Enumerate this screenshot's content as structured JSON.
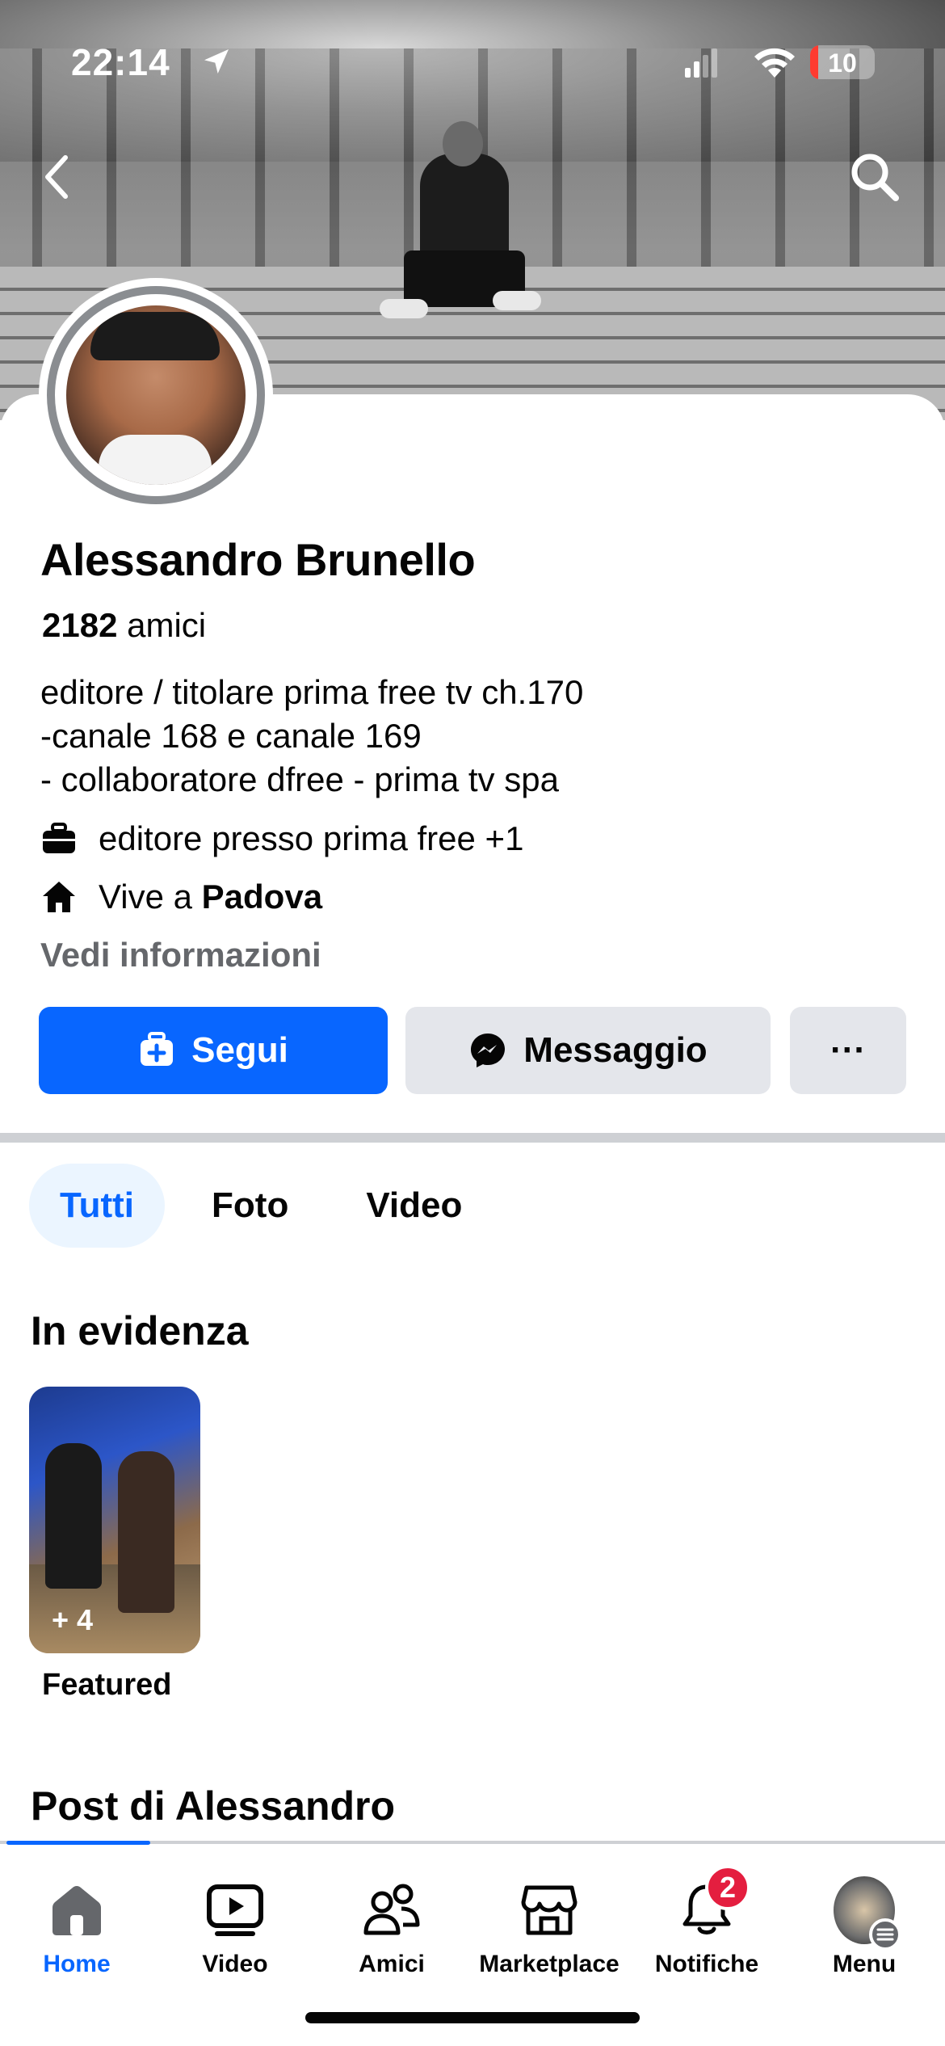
{
  "status_bar": {
    "time": "22:14",
    "battery": "10"
  },
  "profile": {
    "name": "Alessandro Brunello",
    "friends_count": "2182",
    "friends_label": "amici",
    "bio_lines": [
      "editore / titolare prima free tv ch.170",
      "-canale 168 e canale 169",
      "- collaboratore dfree - prima tv spa"
    ],
    "work": "editore presso prima free +1",
    "lives_prefix": "Vive a",
    "lives_city": "Padova",
    "see_info": "Vedi informazioni"
  },
  "actions": {
    "follow": "Segui",
    "message": "Messaggio",
    "more": "···"
  },
  "tabs": [
    {
      "label": "Tutti",
      "active": true
    },
    {
      "label": "Foto",
      "active": false
    },
    {
      "label": "Video",
      "active": false
    }
  ],
  "featured": {
    "title": "In evidenza",
    "item_count_label": "+ 4",
    "item_label": "Featured"
  },
  "posts": {
    "title": "Post di Alessandro"
  },
  "tabbar": {
    "items": [
      {
        "label": "Home",
        "icon": "home-icon",
        "active": true
      },
      {
        "label": "Video",
        "icon": "video-icon",
        "active": false
      },
      {
        "label": "Amici",
        "icon": "friends-icon",
        "active": false
      },
      {
        "label": "Marketplace",
        "icon": "marketplace-icon",
        "active": false
      },
      {
        "label": "Notifiche",
        "icon": "bell-icon",
        "active": false,
        "badge": "2"
      },
      {
        "label": "Menu",
        "icon": "menu-avatar-icon",
        "active": false
      }
    ]
  },
  "colors": {
    "accent": "#0866ff",
    "secondary_button": "#e4e6eb",
    "badge": "#e41e3f",
    "muted_text": "#65676b"
  }
}
